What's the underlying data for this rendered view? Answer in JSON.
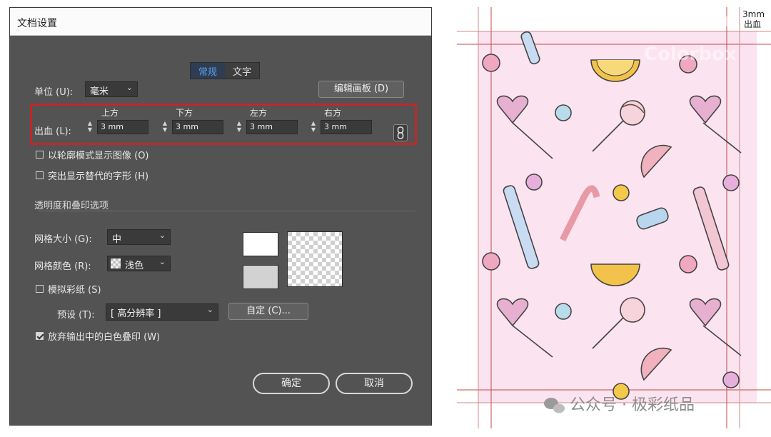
{
  "dialog": {
    "title": "文档设置",
    "tabs": [
      {
        "label": "常规",
        "active": true
      },
      {
        "label": "文字",
        "active": false
      }
    ],
    "unit": {
      "label": "单位 (U):",
      "value": "毫米"
    },
    "edit_artboards_label": "编辑画板 (D)",
    "bleed": {
      "label": "出血 (L):",
      "top": {
        "label": "上方",
        "value": "3 mm"
      },
      "bottom": {
        "label": "下方",
        "value": "3 mm"
      },
      "left": {
        "label": "左方",
        "value": "3 mm"
      },
      "right": {
        "label": "右方",
        "value": "3 mm"
      }
    },
    "options": {
      "outline_mode": {
        "label": "以轮廓模式显示图像 (O)",
        "checked": false
      },
      "highlight_glyphs": {
        "label": "突出显示替代的字形 (H)",
        "checked": false
      }
    },
    "transparency_section": "透明度和叠印选项",
    "grid_size": {
      "label": "网格大小 (G):",
      "value": "中"
    },
    "grid_colors": {
      "label": "网格颜色 (R):",
      "value": "浅色"
    },
    "simulate_paper": {
      "label": "模拟彩纸 (S)",
      "checked": false
    },
    "preset": {
      "label": "预设 (T):",
      "value": "[ 高分辨率 ]"
    },
    "custom_label": "自定 (C)...",
    "discard_white_overprint": {
      "label": "放弃输出中的白色叠印 (W)",
      "checked": true
    },
    "ok_label": "确定",
    "cancel_label": "取消"
  },
  "artwork": {
    "bleed_tag_1": "3mm",
    "bleed_tag_2": "出血",
    "watermark_logo": "极彩纸品",
    "watermark_latin": "Colorbox",
    "watermark_footer": "公众号 · 极彩纸品",
    "background_color": "#fbe3ef",
    "bleed_line_color": "#c44a4a"
  }
}
